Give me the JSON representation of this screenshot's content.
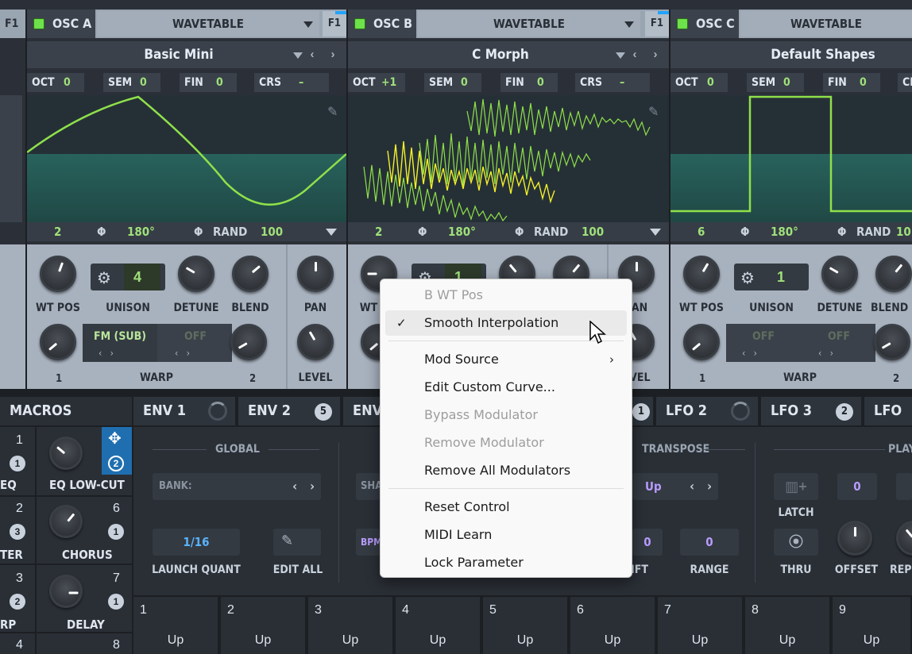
{
  "osc_a": {
    "name": "OSC A",
    "type": "WAVETABLE",
    "f1": "F1",
    "preset": "Basic Mini",
    "oct": "0",
    "sem": "0",
    "fin": "0",
    "crs": "–",
    "pos": "2",
    "phase": "180°",
    "rand": "RAND",
    "rand_val": "100",
    "wt_pos": "WT POS",
    "unison": "UNISON",
    "unison_val": "4",
    "detune": "DETUNE",
    "blend": "BLEND",
    "pan": "PAN",
    "level": "LEVEL",
    "warp1": "FM (SUB)",
    "warp2": "OFF",
    "warp": "WARP",
    "w1": "1",
    "w2": "2"
  },
  "osc_b": {
    "name": "OSC B",
    "type": "WAVETABLE",
    "f1": "F1",
    "preset": "C Morph",
    "oct": "+1",
    "sem": "0",
    "fin": "0",
    "crs": "–",
    "pos": "2",
    "phase": "180°",
    "rand": "RAND",
    "rand_val": "100",
    "unison_val": "1",
    "wt": "WT",
    "pan": "PAN",
    "level": "EVEL"
  },
  "osc_c": {
    "name": "OSC C",
    "type": "WAVETABLE",
    "preset": "Default Shapes",
    "oct": "0",
    "sem": "0",
    "fin": "0",
    "crs": "CR",
    "pos": "6",
    "phase": "180°",
    "rand": "RAND",
    "rand_val": "10",
    "wt_pos": "WT POS",
    "unison": "UNISON",
    "unison_val": "1",
    "detune": "DETUNE",
    "blend": "BLEND",
    "warp1": "OFF",
    "warp2": "OFF",
    "warp": "WARP",
    "w1": "1",
    "w2": "2"
  },
  "labels": {
    "oct": "OCT",
    "sem": "SEM",
    "fin": "FIN",
    "crs": "CRS",
    "f1": "F1",
    "phase_icon": "Φ",
    "arrows": "‹ ›"
  },
  "tabs": {
    "macros": "MACROS",
    "env1": "ENV 1",
    "env2": "ENV 2",
    "env2_badge": "5",
    "env3": "ENV",
    "lfo1_badge": "1",
    "lfo2": "LFO 2",
    "lfo3": "LFO 3",
    "lfo3_badge": "2",
    "lfo4": "LFO 4"
  },
  "macros": [
    {
      "n": "1",
      "badge": "1",
      "label": "EQ"
    },
    {
      "n": "",
      "badge": "2",
      "label": "EQ LOW-CUT"
    },
    {
      "n": "2",
      "badge": "3",
      "label": "TER"
    },
    {
      "n": "6",
      "badge": "1",
      "label": "CHORUS"
    },
    {
      "n": "3",
      "badge": "2",
      "label": "RP"
    },
    {
      "n": "7",
      "badge": "1",
      "label": "DELAY"
    },
    {
      "n": "4",
      "badge": "",
      "label": ""
    },
    {
      "n": "8",
      "badge": "",
      "label": ""
    }
  ],
  "env_panel": {
    "global": "GLOBAL",
    "bank": "BANK:",
    "launch_val": "1/16",
    "launch": "LAUNCH QUANT",
    "edit_all": "EDIT ALL",
    "sha": "SHA",
    "bpm": "BPM"
  },
  "lfo_panel": {
    "transpose": "TRANSPOSE",
    "up": "Up",
    "shift_val": "0",
    "shift": "IFT",
    "range_val": "0",
    "range": "RANGE",
    "latch": "LATCH",
    "thru": "THRU",
    "play": "PLAY",
    "zero": "0",
    "offset": "OFFSET",
    "rep": "REP"
  },
  "seq": [
    {
      "n": "1",
      "v": "Up"
    },
    {
      "n": "2",
      "v": "Up"
    },
    {
      "n": "3",
      "v": "Up"
    },
    {
      "n": "4",
      "v": "Up"
    },
    {
      "n": "5",
      "v": "Up"
    },
    {
      "n": "6",
      "v": "Up"
    },
    {
      "n": "7",
      "v": "Up"
    },
    {
      "n": "8",
      "v": "Up"
    },
    {
      "n": "9",
      "v": "Up"
    }
  ],
  "menu": {
    "header": "B WT Pos",
    "smooth": "Smooth Interpolation",
    "check": "✓",
    "mod_source": "Mod Source",
    "sub_arrow": "›",
    "edit_curve": "Edit Custom Curve...",
    "bypass": "Bypass Modulator",
    "remove": "Remove Modulator",
    "remove_all": "Remove All Modulators",
    "reset": "Reset Control",
    "midi": "MIDI Learn",
    "lock": "Lock Parameter"
  },
  "colors": {
    "accent_green": "#9fe07a",
    "wave_green": "#8fe04a",
    "wave_yellow": "#f2ef2a",
    "highlight_blue": "#21a4ff",
    "purple": "#b89cff"
  }
}
